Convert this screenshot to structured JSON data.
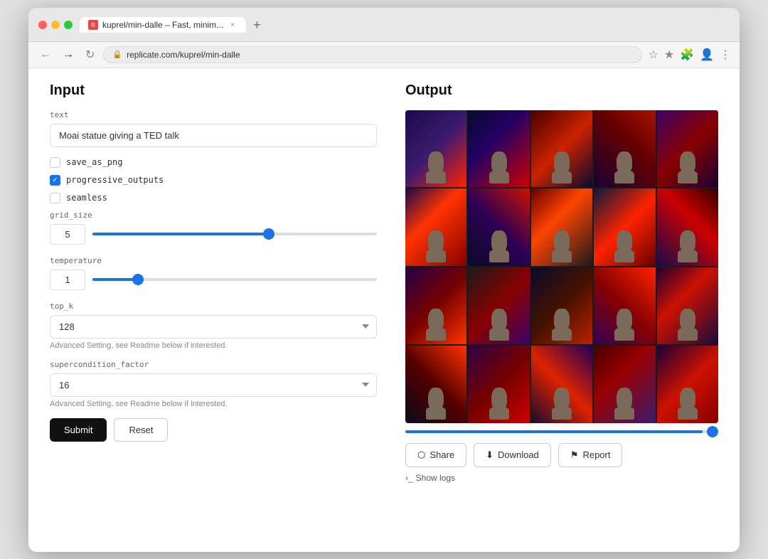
{
  "browser": {
    "tab_title": "kuprel/min-dalle – Fast, minim...",
    "url": "replicate.com/kuprel/min-dalle",
    "new_tab_label": "+"
  },
  "input": {
    "section_title": "Input",
    "text_label": "text",
    "text_value": "Moai statue giving a TED talk",
    "save_as_png_label": "save_as_png",
    "save_as_png_checked": false,
    "progressive_outputs_label": "progressive_outputs",
    "progressive_outputs_checked": true,
    "seamless_label": "seamless",
    "seamless_checked": false,
    "grid_size_label": "grid_size",
    "grid_size_value": "5",
    "temperature_label": "temperature",
    "temperature_value": "1",
    "top_k_label": "top_k",
    "top_k_value": "128",
    "top_k_hint": "Advanced Setting, see Readme below if interested.",
    "supercondition_label": "supercondition_factor",
    "supercondition_value": "16",
    "supercondition_hint": "Advanced Setting, see Readme below if interested.",
    "submit_label": "Submit",
    "reset_label": "Reset"
  },
  "output": {
    "section_title": "Output",
    "share_label": "Share",
    "download_label": "Download",
    "report_label": "Report",
    "show_logs_label": "Show logs"
  },
  "icons": {
    "share": "⬡",
    "download": "⬇",
    "report": "⚑",
    "show_logs": "›_",
    "lock": "🔒",
    "back": "←",
    "forward": "→",
    "refresh": "↻",
    "bookmark": "☆",
    "extension": "🧩",
    "menu": "⋮"
  }
}
